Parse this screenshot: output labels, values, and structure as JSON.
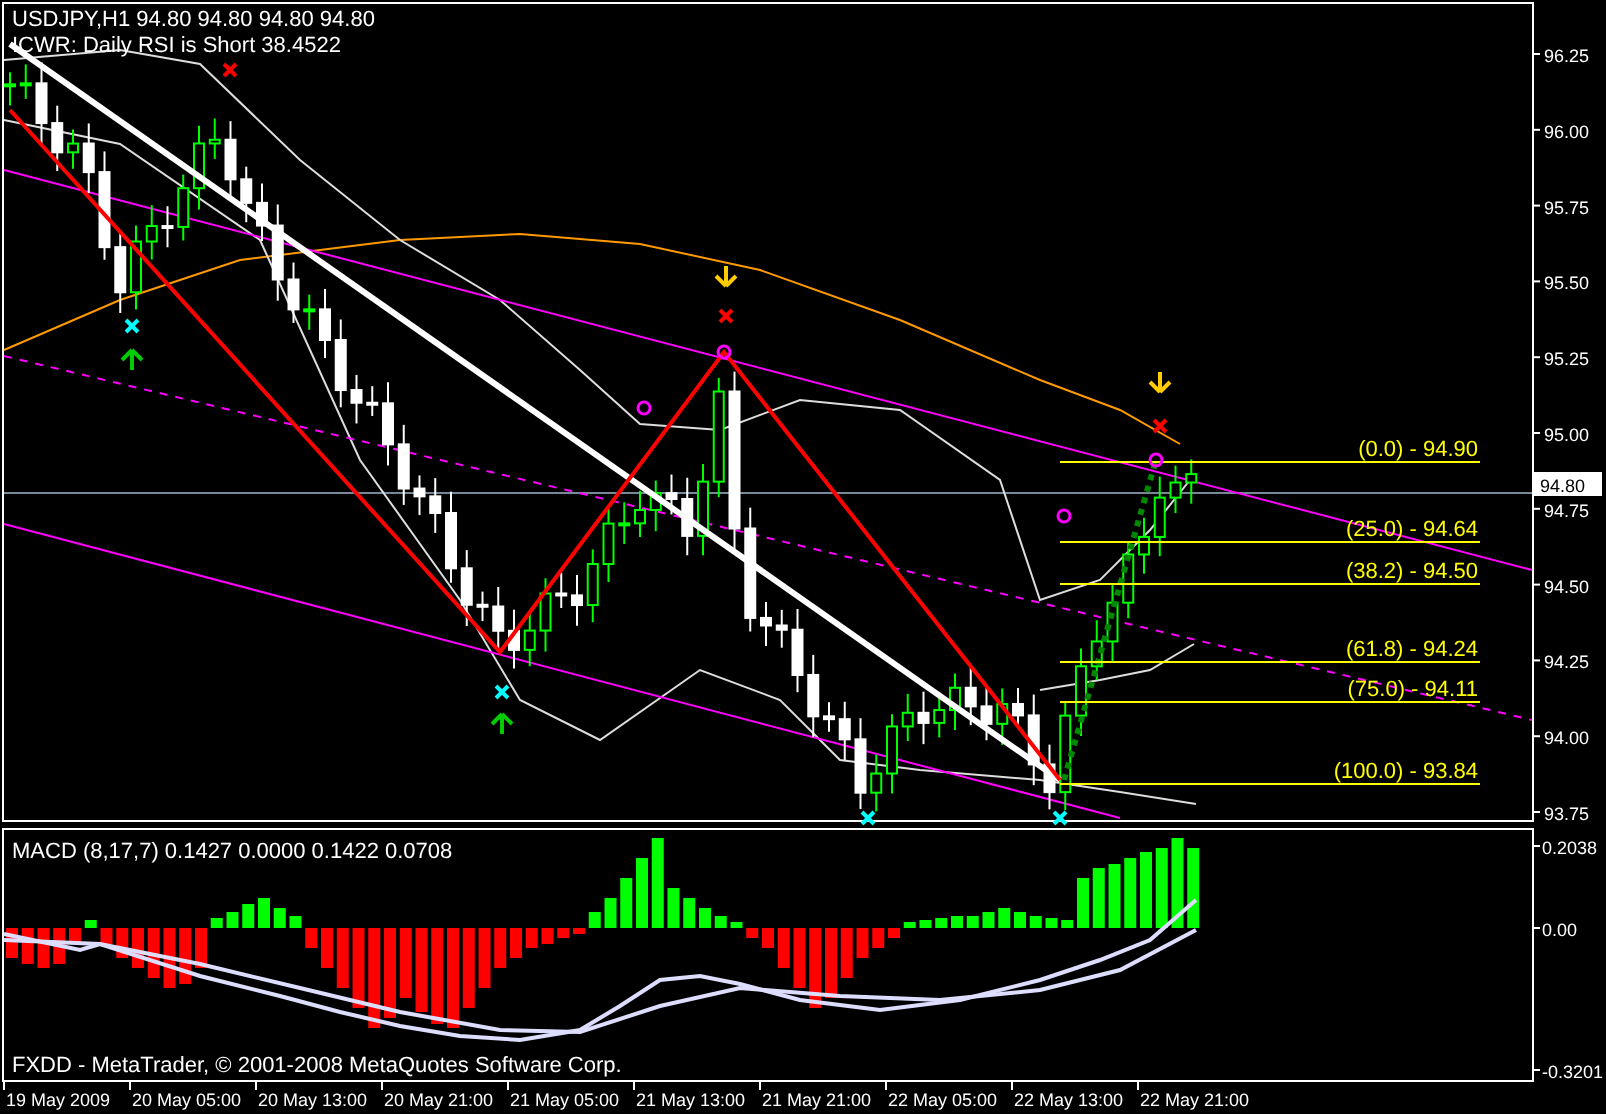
{
  "header": {
    "symbol_line": "USDJPY,H1 94.80 94.80 94.80 94.80",
    "comment": "ICWR: Daily RSI is Short 38.4522"
  },
  "price_axis": [
    "96.25",
    "96.00",
    "95.75",
    "95.50",
    "95.25",
    "95.00",
    "94.75",
    "94.50",
    "94.25",
    "94.00",
    "93.75"
  ],
  "current_price": "94.80",
  "fib_levels": [
    "(0.0) - 94.90",
    "(25.0) - 94.64",
    "(38.2) - 94.50",
    "(61.8) - 94.24",
    "(75.0) - 94.11",
    "(100.0) - 93.84"
  ],
  "macd": {
    "label": "MACD (8,17,7) 0.1427 0.0000 0.1422 0.0708",
    "axis": [
      "0.2038",
      "0.00",
      "-0.3201"
    ]
  },
  "copyright": "FXDD - MetaTrader, © 2001-2008 MetaQuotes Software Corp.",
  "time_axis": [
    "19 May 2009",
    "20 May 05:00",
    "20 May 13:00",
    "20 May 21:00",
    "21 May 05:00",
    "21 May 13:00",
    "21 May 21:00",
    "22 May 05:00",
    "22 May 13:00",
    "22 May 21:00"
  ]
}
